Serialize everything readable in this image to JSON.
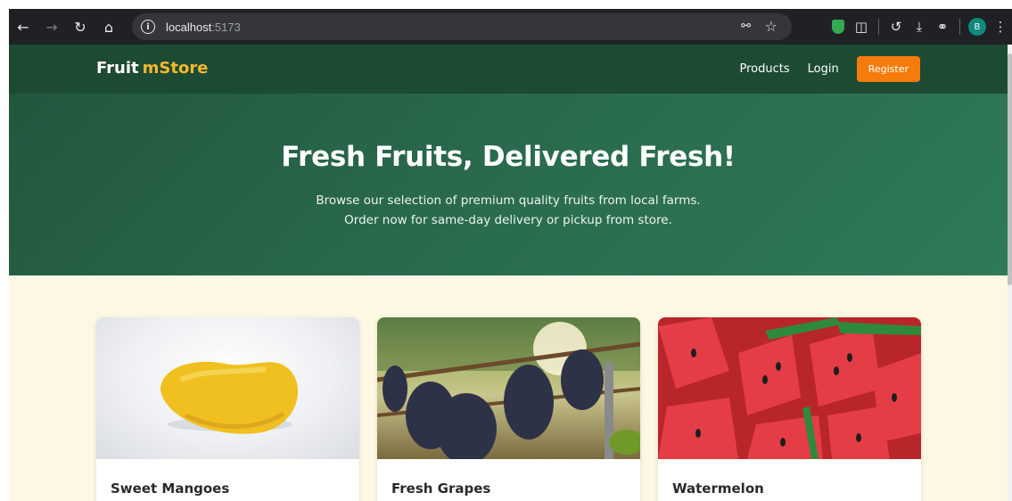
{
  "browser": {
    "url_host": "localhost",
    "url_port": ":5173",
    "avatar_letter": "B",
    "icons": [
      "back-icon",
      "forward-icon",
      "reload-icon",
      "home-icon",
      "site-info-icon",
      "password-key-icon",
      "bookmark-star-icon",
      "shield-extension-icon",
      "extensions-puzzle-icon",
      "history-icon",
      "download-icon",
      "link-icon",
      "menu-kebab-icon"
    ]
  },
  "navbar": {
    "brand_main": "Fruit",
    "brand_accent": "mStore",
    "links": [
      "Products",
      "Login"
    ],
    "register_label": "Register"
  },
  "hero": {
    "title": "Fresh Fruits, Delivered Fresh!",
    "line1": "Browse our selection of premium quality fruits from local farms.",
    "line2": "Order now for same-day delivery or pickup from store."
  },
  "products": [
    {
      "name": "Sweet Mangoes",
      "image": "mango"
    },
    {
      "name": "Fresh Grapes",
      "image": "grapes"
    },
    {
      "name": "Watermelon",
      "image": "watermelon"
    }
  ],
  "colors": {
    "navbar": "#1d4a33",
    "hero": "#2a6b4d",
    "brand_accent": "#f5b82e",
    "register_button": "#f57c0c",
    "page_background": "#fdf8e4"
  }
}
